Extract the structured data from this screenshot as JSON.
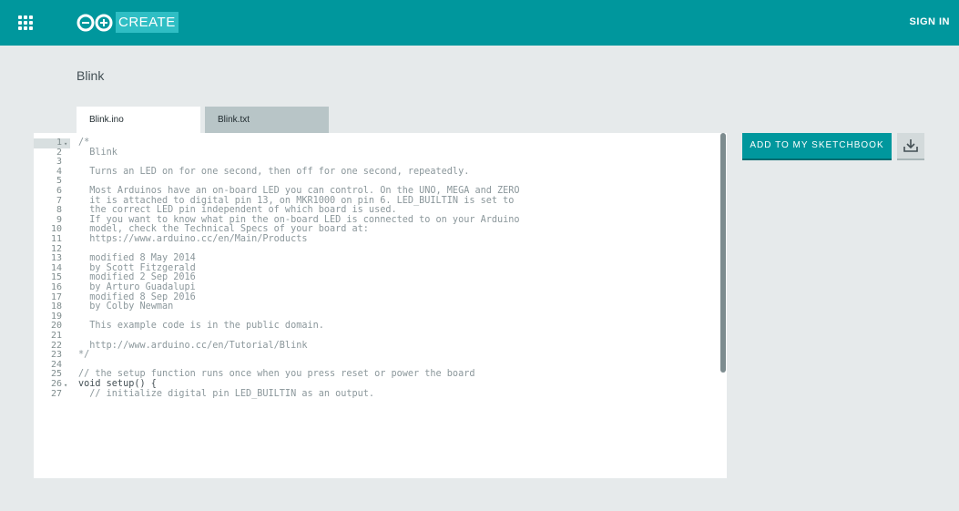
{
  "header": {
    "create_label": "CREATE",
    "signin_label": "SIGN IN",
    "brand_color": "#00979d"
  },
  "sketch": {
    "title": "Blink"
  },
  "tabs": [
    {
      "label": "Blink.ino",
      "active": true
    },
    {
      "label": "Blink.txt",
      "active": false
    }
  ],
  "actions": {
    "add_label": "ADD TO MY SKETCHBOOK",
    "download_icon": "download-icon"
  },
  "code": {
    "lines": [
      {
        "n": "1",
        "fold": true,
        "text": "/*"
      },
      {
        "n": "2",
        "text": "  Blink"
      },
      {
        "n": "3",
        "text": ""
      },
      {
        "n": "4",
        "text": "  Turns an LED on for one second, then off for one second, repeatedly."
      },
      {
        "n": "5",
        "text": ""
      },
      {
        "n": "6",
        "text": "  Most Arduinos have an on-board LED you can control. On the UNO, MEGA and ZERO"
      },
      {
        "n": "7",
        "text": "  it is attached to digital pin 13, on MKR1000 on pin 6. LED_BUILTIN is set to"
      },
      {
        "n": "8",
        "text": "  the correct LED pin independent of which board is used."
      },
      {
        "n": "9",
        "text": "  If you want to know what pin the on-board LED is connected to on your Arduino"
      },
      {
        "n": "10",
        "text": "  model, check the Technical Specs of your board at:"
      },
      {
        "n": "11",
        "text": "  https://www.arduino.cc/en/Main/Products"
      },
      {
        "n": "12",
        "text": ""
      },
      {
        "n": "13",
        "text": "  modified 8 May 2014"
      },
      {
        "n": "14",
        "text": "  by Scott Fitzgerald"
      },
      {
        "n": "15",
        "text": "  modified 2 Sep 2016"
      },
      {
        "n": "16",
        "text": "  by Arturo Guadalupi"
      },
      {
        "n": "17",
        "text": "  modified 8 Sep 2016"
      },
      {
        "n": "18",
        "text": "  by Colby Newman"
      },
      {
        "n": "19",
        "text": ""
      },
      {
        "n": "20",
        "text": "  This example code is in the public domain."
      },
      {
        "n": "21",
        "text": ""
      },
      {
        "n": "22",
        "text": "  http://www.arduino.cc/en/Tutorial/Blink"
      },
      {
        "n": "23",
        "text": "*/"
      },
      {
        "n": "24",
        "text": ""
      },
      {
        "n": "25",
        "text": "// the setup function runs once when you press reset or power the board"
      },
      {
        "n": "26",
        "fold": true,
        "text": "void setup() {"
      },
      {
        "n": "27",
        "text": "  // initialize digital pin LED_BUILTIN as an output."
      }
    ]
  }
}
